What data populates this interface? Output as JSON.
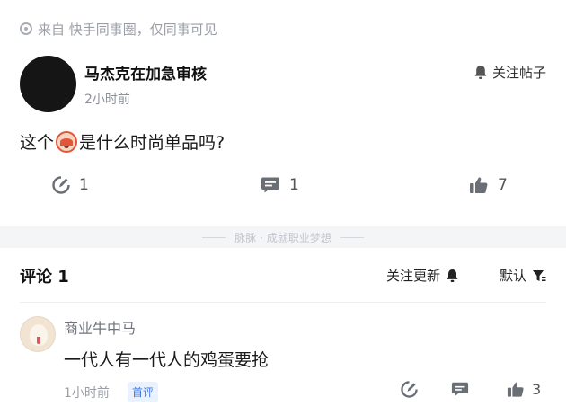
{
  "source": {
    "text": "来自 快手同事圈，仅同事可见"
  },
  "post": {
    "author": "马杰克在加急审核",
    "time": "2小时前",
    "follow_label": "关注帖子",
    "body_before": "这个",
    "body_after": "是什么时尚单品吗?",
    "emoji_icon": "face-emoji-icon",
    "actions": {
      "comment_count": "1",
      "reply_count": "1",
      "like_count": "7"
    }
  },
  "separator": {
    "text": "脉脉 · 成就职业梦想"
  },
  "comments": {
    "title": "评论 1",
    "follow_updates_label": "关注更新",
    "sort_label": "默认",
    "items": [
      {
        "author": "商业牛中马",
        "text": "一代人有一代人的鸡蛋要抢",
        "time": "1小时前",
        "badge": "首评",
        "like_count": "3"
      }
    ]
  },
  "colors": {
    "accent_blue": "#3b78e7",
    "muted": "#9a9ea6"
  }
}
